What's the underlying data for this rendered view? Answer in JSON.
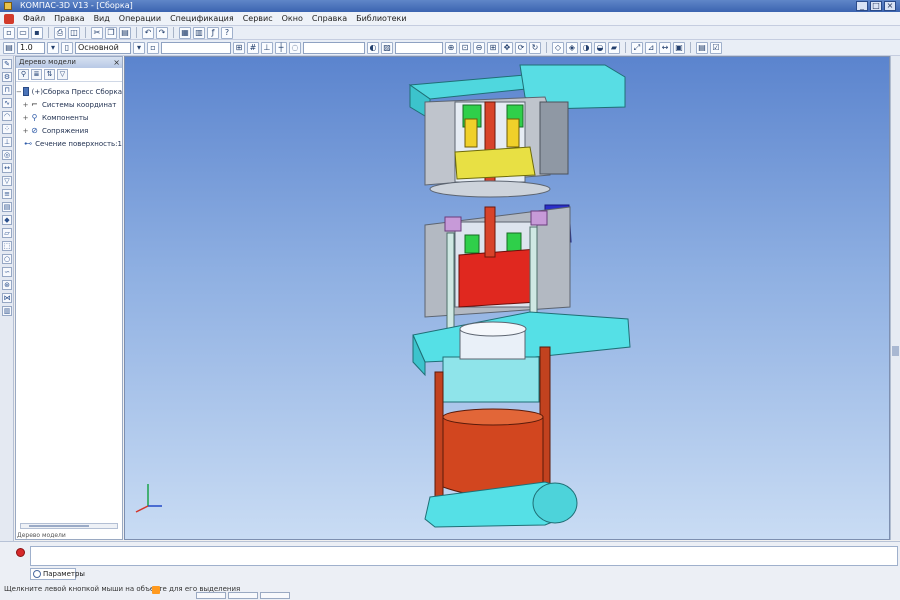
{
  "window": {
    "title": "КОМПАС-3D V13 - [Сборка]"
  },
  "menu": [
    "Файл",
    "Правка",
    "Вид",
    "Операции",
    "Спецификация",
    "Сервис",
    "Окно",
    "Справка",
    "Библиотеки"
  ],
  "toolbar": {
    "scale_value": "1.0",
    "style_value": "Основной"
  },
  "tree": {
    "header": "Дерево модели",
    "items": [
      {
        "label": "(+)Сборка Пресс Сборка",
        "expand": "−",
        "icon": "assembly-icon"
      },
      {
        "label": "Системы координат",
        "expand": "+",
        "icon": "coordinate-system-icon"
      },
      {
        "label": "Компоненты",
        "expand": "+",
        "icon": "components-icon"
      },
      {
        "label": "Сопряжения",
        "expand": "+",
        "icon": "mates-icon"
      },
      {
        "label": "Сечение поверхность:1",
        "expand": "",
        "icon": "section-icon"
      }
    ],
    "footer": "Дерево модели"
  },
  "prompt": {
    "tab_label": "Параметры"
  },
  "status": {
    "hint": "Щелкните левой кнопкой мыши на объекте для его выделения"
  },
  "colors": {
    "viewport_top": "#5b84ce",
    "viewport_bottom": "#c9dcf4",
    "part_cyan": "#55e0e6",
    "part_red": "#d8432a",
    "part_blue": "#2b2fc8",
    "part_green": "#2fcf4a",
    "part_yellow": "#e8e044",
    "part_grey": "#b9bfc7"
  }
}
